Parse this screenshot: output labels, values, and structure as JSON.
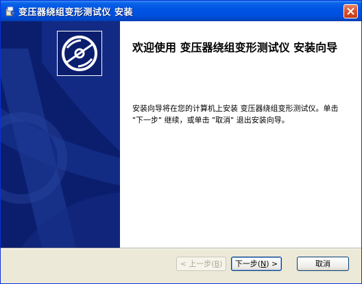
{
  "window": {
    "title": "变压器绕组变形测试仪  安装",
    "app_icon": "installer-icon",
    "close_icon": "close-icon"
  },
  "banner": {
    "icon": "cd-disc-icon"
  },
  "main": {
    "welcome_heading": "欢迎使用 变压器绕组变形测试仪 安装向导",
    "description": "安装向导将在您的计算机上安装 变压器绕组变形测试仪。单击 \"下一步\" 继续，或单击 \"取消\" 退出安装向导。"
  },
  "buttons": {
    "back": {
      "text": "< 上一步(",
      "key": "B",
      "end": ")"
    },
    "next": {
      "text": "下一步(",
      "key": "N",
      "end": ") >"
    },
    "cancel": "取消"
  },
  "colors": {
    "title_bar": "#0054e3",
    "banner": "#0b1e6e",
    "dialog_bg": "#ece9d8",
    "close_button": "#d6552f"
  }
}
